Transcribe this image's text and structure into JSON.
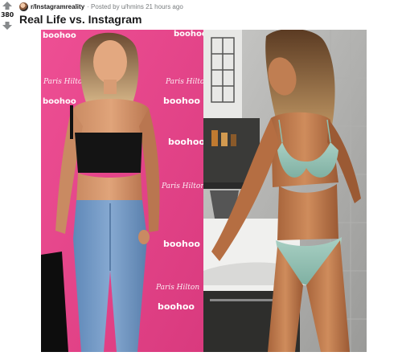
{
  "post": {
    "score": "380",
    "subreddit": "r/Instagramreality",
    "posted_by": "· Posted by u/hmins 21 hours ago",
    "title": "Real Life vs. Instagram"
  },
  "image": {
    "left_panel": {
      "logos": [
        "boohoo",
        "boohoo",
        "boohoo",
        "boohoo",
        "boohoo",
        "boohoo",
        "boohoo"
      ],
      "scripts": [
        "Paris Hilton",
        "Paris Hilton",
        "Paris Hilton",
        "Paris Hilton"
      ]
    }
  },
  "colors": {
    "backdrop_pink": "#e8468b",
    "score_text": "#1a1a1b",
    "meta_gray": "#787c7e",
    "vote_arrow": "#878a8c"
  },
  "icons": {
    "upvote": "upvote-arrow-icon",
    "downvote": "downvote-arrow-icon"
  }
}
